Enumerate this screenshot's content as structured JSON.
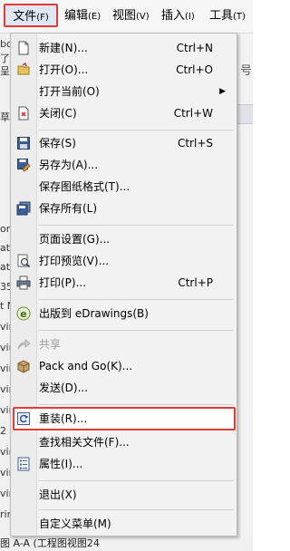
{
  "menubar": {
    "items": [
      {
        "label": "文件",
        "mnemonic": "(F)"
      },
      {
        "label": "编辑",
        "mnemonic": "(E)"
      },
      {
        "label": "视图",
        "mnemonic": "(V)"
      },
      {
        "label": "插入",
        "mnemonic": "(I)"
      },
      {
        "label": "工具",
        "mnemonic": "(T)"
      }
    ]
  },
  "background": {
    "left_glyphs": [
      "bo",
      "了",
      "呈",
      "草",
      "or",
      "at",
      "at",
      "35",
      "t N",
      "vin",
      "vin",
      "vin",
      "vin",
      "vin",
      "2",
      "vin",
      "vin",
      "vin",
      "rin"
    ],
    "right_glyph": "号",
    "bottom_text": "图 A-A (工程图视图24"
  },
  "menu": {
    "items": [
      {
        "label": "新建(N)...",
        "shortcut": "Ctrl+N",
        "icon": "new-document-icon"
      },
      {
        "label": "打开(O)...",
        "shortcut": "Ctrl+O",
        "icon": "open-folder-icon"
      },
      {
        "label": "打开当前(O)",
        "shortcut": "",
        "icon": "",
        "submenu": true
      },
      {
        "label": "关闭(C)",
        "shortcut": "Ctrl+W",
        "icon": "close-document-icon"
      },
      {
        "label": "保存(S)",
        "shortcut": "Ctrl+S",
        "icon": "save-disk-icon"
      },
      {
        "label": "另存为(A)...",
        "shortcut": "",
        "icon": "save-as-icon"
      },
      {
        "label": "保存图纸格式(T)...",
        "shortcut": "",
        "icon": ""
      },
      {
        "label": "保存所有(L)",
        "shortcut": "",
        "icon": "save-all-icon"
      },
      {
        "label": "页面设置(G)...",
        "shortcut": "",
        "icon": ""
      },
      {
        "label": "打印预览(V)...",
        "shortcut": "",
        "icon": "print-preview-icon"
      },
      {
        "label": "打印(P)...",
        "shortcut": "Ctrl+P",
        "icon": "printer-icon"
      },
      {
        "label": "出版到 eDrawings(B)",
        "shortcut": "",
        "icon": "edrawings-icon"
      },
      {
        "label": "共享",
        "shortcut": "",
        "icon": "share-icon",
        "disabled": true
      },
      {
        "label": "Pack and Go(K)...",
        "shortcut": "",
        "icon": "pack-and-go-icon"
      },
      {
        "label": "发送(D)...",
        "shortcut": "",
        "icon": ""
      },
      {
        "label": "重装(R)...",
        "shortcut": "",
        "icon": "reload-icon"
      },
      {
        "label": "查找相关文件(F)...",
        "shortcut": "",
        "icon": ""
      },
      {
        "label": "属性(I)...",
        "shortcut": "",
        "icon": "properties-icon"
      },
      {
        "label": "退出(X)",
        "shortcut": "",
        "icon": ""
      },
      {
        "label": "自定义菜单(M)",
        "shortcut": "",
        "icon": ""
      }
    ]
  },
  "colors": {
    "highlight_border": "#e53935",
    "menu_bg": "#f2f2f2",
    "selected_tab_bg": "#dde6f3"
  }
}
